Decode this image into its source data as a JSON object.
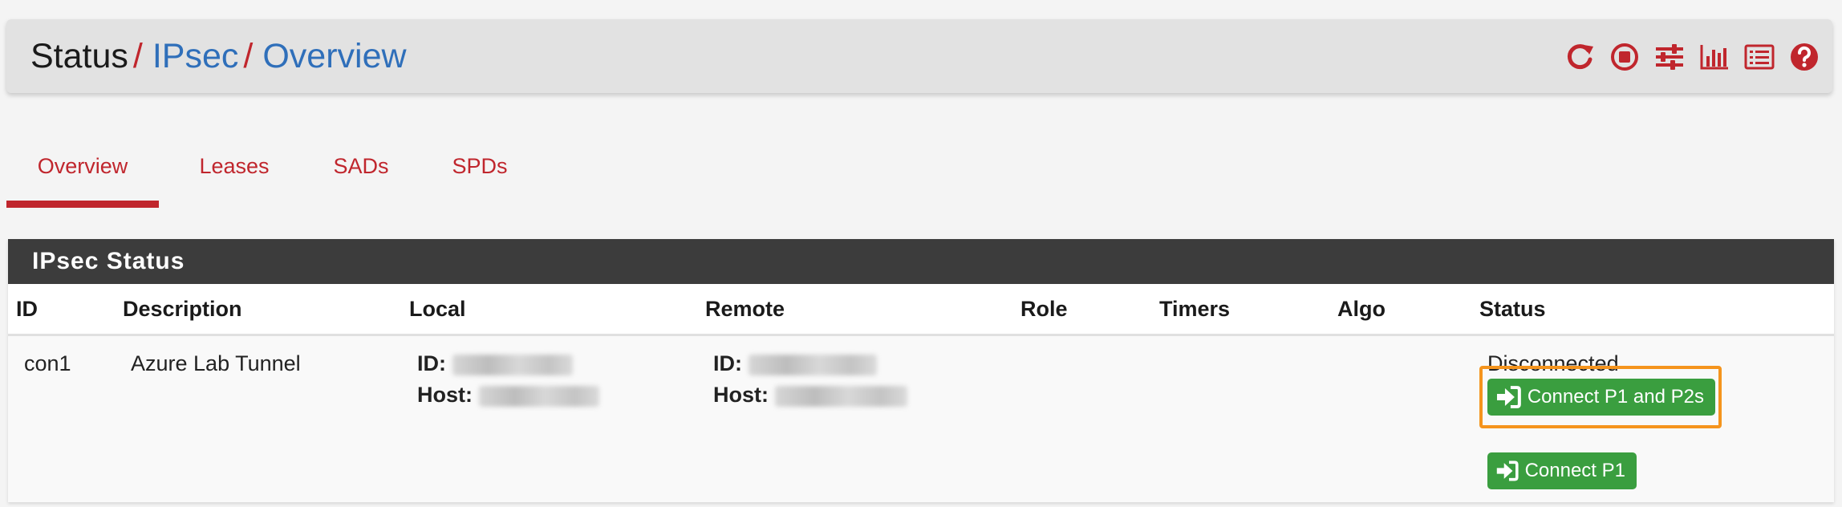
{
  "breadcrumb": {
    "items": [
      "Status",
      "IPsec",
      "Overview"
    ],
    "separator": "/"
  },
  "header_icons": [
    "restart-icon",
    "stop-icon",
    "settings-sliders-icon",
    "bar-chart-icon",
    "log-list-icon",
    "help-icon"
  ],
  "tabs": [
    {
      "label": "Overview",
      "active": true
    },
    {
      "label": "Leases",
      "active": false
    },
    {
      "label": "SADs",
      "active": false
    },
    {
      "label": "SPDs",
      "active": false
    }
  ],
  "panel": {
    "title": "IPsec Status",
    "columns": [
      "ID",
      "Description",
      "Local",
      "Remote",
      "Role",
      "Timers",
      "Algo",
      "Status"
    ],
    "rows": [
      {
        "id": "con1",
        "description": "Azure Lab Tunnel",
        "local": {
          "id_label": "ID:",
          "host_label": "Host:"
        },
        "remote": {
          "id_label": "ID:",
          "host_label": "Host:"
        },
        "status": "Disconnected",
        "buttons": [
          "Connect P1 and P2s",
          "Connect P1"
        ]
      }
    ]
  },
  "colors": {
    "accent_red": "#c0262d",
    "link_blue": "#2f6fba",
    "button_green": "#3a9e3f",
    "highlight_orange": "#f5941d",
    "panel_header": "#3c3c3c"
  }
}
